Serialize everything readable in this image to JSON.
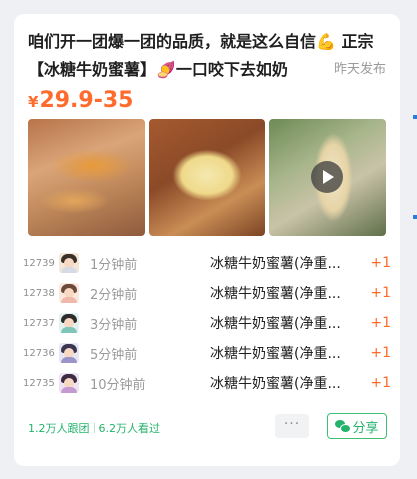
{
  "post": {
    "title": "咱们开一团爆一团的品质，就是这么自信💪 正宗【冰糖牛奶蜜薯】🍠一口咬下去如奶",
    "published": "昨天发布",
    "currency": "¥",
    "price": "29.9-35",
    "images": [
      {
        "name": "roasted-sweet-potatoes-photo"
      },
      {
        "name": "split-sweet-potato-photo"
      },
      {
        "name": "sweet-potato-video-thumbnail",
        "video": true
      }
    ]
  },
  "orders": [
    {
      "num": "12739",
      "time": "1分钟前",
      "product": "冰糖牛奶蜜薯(净重...",
      "qty": "+1"
    },
    {
      "num": "12738",
      "time": "2分钟前",
      "product": "冰糖牛奶蜜薯(净重...",
      "qty": "+1"
    },
    {
      "num": "12737",
      "time": "3分钟前",
      "product": "冰糖牛奶蜜薯(净重...",
      "qty": "+1"
    },
    {
      "num": "12736",
      "time": "5分钟前",
      "product": "冰糖牛奶蜜薯(净重...",
      "qty": "+1"
    },
    {
      "num": "12735",
      "time": "10分钟前",
      "product": "冰糖牛奶蜜薯(净重...",
      "qty": "+1"
    }
  ],
  "footer": {
    "followers": "1.2万人跟团",
    "views": "6.2万人看过",
    "more_label": "···",
    "share_label": "分享"
  },
  "colors": {
    "accent": "#ff6b2c",
    "green": "#24b36b"
  }
}
